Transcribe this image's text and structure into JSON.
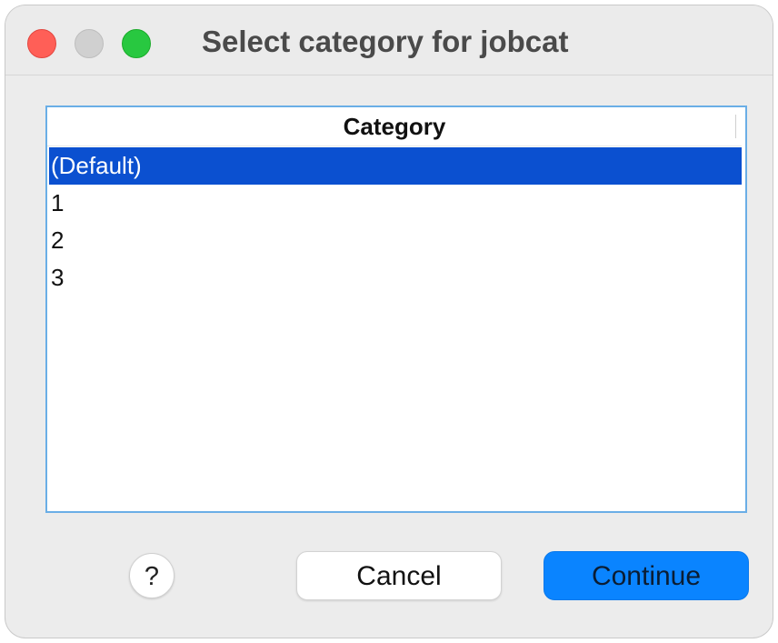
{
  "window": {
    "title": "Select category for jobcat"
  },
  "list": {
    "header": "Category",
    "items": [
      {
        "label": "(Default)",
        "selected": true
      },
      {
        "label": "1",
        "selected": false
      },
      {
        "label": "2",
        "selected": false
      },
      {
        "label": "3",
        "selected": false
      }
    ]
  },
  "buttons": {
    "help_label": "?",
    "cancel_label": "Cancel",
    "continue_label": "Continue"
  },
  "colors": {
    "selection": "#0b50d0",
    "accent": "#0a84ff",
    "close": "#ff5f57",
    "minimize": "#d0d0d0",
    "maximize": "#28c840"
  },
  "icons": {
    "close": "close-window-icon",
    "minimize": "minimize-window-icon",
    "maximize": "maximize-window-icon",
    "help": "help-icon"
  }
}
